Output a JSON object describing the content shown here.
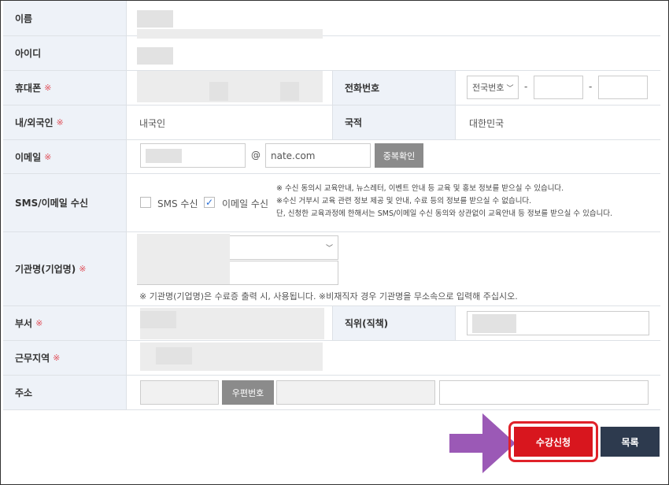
{
  "required_mark": "※",
  "fields": {
    "name_label": "이름",
    "id_label": "아이디",
    "mobile_label": "휴대폰",
    "phone_label": "전화번호",
    "phone_area_select": "전국번호",
    "dash": "-",
    "nationality_type_label": "내/외국인",
    "nationality_type_value": "내국인",
    "nationality_label": "국적",
    "nationality_value": "대한민국",
    "email_label": "이메일",
    "email_at": "@",
    "email_domain": "nate.com",
    "email_check_button": "중복확인",
    "sms_email_label": "SMS/이메일 수신",
    "sms_checkbox_label": "SMS 수신",
    "email_checkbox_label": "이메일 수신",
    "notice_lines": [
      "※ 수신 동의시 교육안내, 뉴스레터, 이벤트 안내 등 교육 및 홍보 정보를 받으실 수 있습니다.",
      "※수신 거부시 교육 관련 정보 제공 및 안내, 수료 등의 정보를 받으실 수 없습니다.",
      "단, 신청한 교육과정에 한해서는 SMS/이메일 수신 동의와 상관없이 교육안내 등 정보를 받으실 수 있습니다."
    ],
    "org_label": "기관명(기업명)",
    "org_notice": "※ 기관명(기업명)은 수료증 출력 시, 사용됩니다. ※비재직자 경우 기관명을 무소속으로 입력해 주십시오.",
    "dept_label": "부서",
    "position_label": "직위(직책)",
    "region_label": "근무지역",
    "address_label": "주소",
    "zipcode_button": "우편번호"
  },
  "actions": {
    "apply_button": "수강신청",
    "list_button": "목록"
  },
  "colors": {
    "apply_bg": "#d8161e",
    "list_bg": "#2d3a4e",
    "highlight_ring": "#e0222a",
    "arrow": "#9b59b6",
    "label_bg": "#eef2f8"
  }
}
